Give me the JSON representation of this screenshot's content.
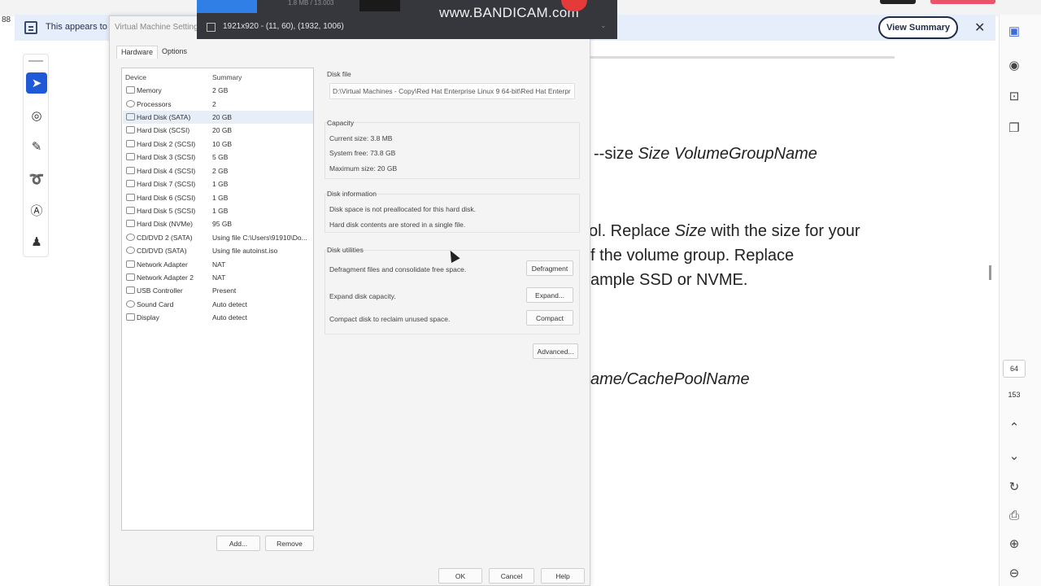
{
  "pdf_viewer": {
    "notice_text": "This appears to b",
    "view_summary_label": "View Summary",
    "close_label": "✕",
    "left_edge_text": "88",
    "doc_lines": [
      {
        "pre": "--size ",
        "italic": "Size VolumeGroupName",
        "post": ""
      },
      {
        "pre": "ol. Replace  ",
        "italic": "Size",
        "post": " with the size for your"
      },
      {
        "pre": "f the volume group. Replace",
        "italic": "",
        "post": ""
      },
      {
        "pre": "ample SSD or NVME.",
        "italic": "",
        "post": ""
      },
      {
        "pre": "",
        "italic": "ame/CachePoolName",
        "post": ""
      }
    ],
    "page_current": "64",
    "page_total": "153"
  },
  "bandicam": {
    "stats": "1.8 MB / 13.003",
    "logo": "www.BANDICAM.com",
    "resolution": "1921x920 - (11, 60), (1932, 1006)",
    "dropdown": "⌄"
  },
  "dialog": {
    "title": "Virtual Machine Settings",
    "tabs": [
      "Hardware",
      "Options"
    ],
    "device_header": "Device",
    "summary_header": "Summary",
    "devices": [
      {
        "name": "Memory",
        "summary": "2 GB"
      },
      {
        "name": "Processors",
        "summary": "2"
      },
      {
        "name": "Hard Disk (SATA)",
        "summary": "20 GB"
      },
      {
        "name": "Hard Disk (SCSI)",
        "summary": "20 GB"
      },
      {
        "name": "Hard Disk 2 (SCSI)",
        "summary": "10 GB"
      },
      {
        "name": "Hard Disk 3 (SCSI)",
        "summary": "5 GB"
      },
      {
        "name": "Hard Disk 4 (SCSI)",
        "summary": "2 GB"
      },
      {
        "name": "Hard Disk 7 (SCSI)",
        "summary": "1 GB"
      },
      {
        "name": "Hard Disk 6 (SCSI)",
        "summary": "1 GB"
      },
      {
        "name": "Hard Disk 5 (SCSI)",
        "summary": "1 GB"
      },
      {
        "name": "Hard Disk (NVMe)",
        "summary": "95 GB"
      },
      {
        "name": "CD/DVD 2 (SATA)",
        "summary": "Using file C:\\Users\\91910\\Do..."
      },
      {
        "name": "CD/DVD (SATA)",
        "summary": "Using file autoinst.iso"
      },
      {
        "name": "Network Adapter",
        "summary": "NAT"
      },
      {
        "name": "Network Adapter 2",
        "summary": "NAT"
      },
      {
        "name": "USB Controller",
        "summary": "Present"
      },
      {
        "name": "Sound Card",
        "summary": "Auto detect"
      },
      {
        "name": "Display",
        "summary": "Auto detect"
      }
    ],
    "add_label": "Add...",
    "remove_label": "Remove",
    "disk_file": {
      "label": "Disk file",
      "path": "D:\\Virtual Machines - Copy\\Red Hat Enterprise Linux 9 64-bit\\Red Hat Enterpr"
    },
    "capacity": {
      "label": "Capacity",
      "current": "Current size: 3.8 MB",
      "free": "System free: 73.8 GB",
      "max": "Maximum size: 20 GB"
    },
    "disk_info": {
      "label": "Disk information",
      "line1": "Disk space is not preallocated for this hard disk.",
      "line2": "Hard disk contents are stored in a single file."
    },
    "disk_utilities": {
      "label": "Disk utilities",
      "defrag_text": "Defragment files and consolidate free space.",
      "defrag_button": "Defragment",
      "expand_text": "Expand disk capacity.",
      "expand_button": "Expand...",
      "compact_text": "Compact disk to reclaim unused space.",
      "compact_button": "Compact"
    },
    "advanced_button": "Advanced...",
    "ok_label": "OK",
    "cancel_label": "Cancel",
    "help_label": "Help"
  }
}
